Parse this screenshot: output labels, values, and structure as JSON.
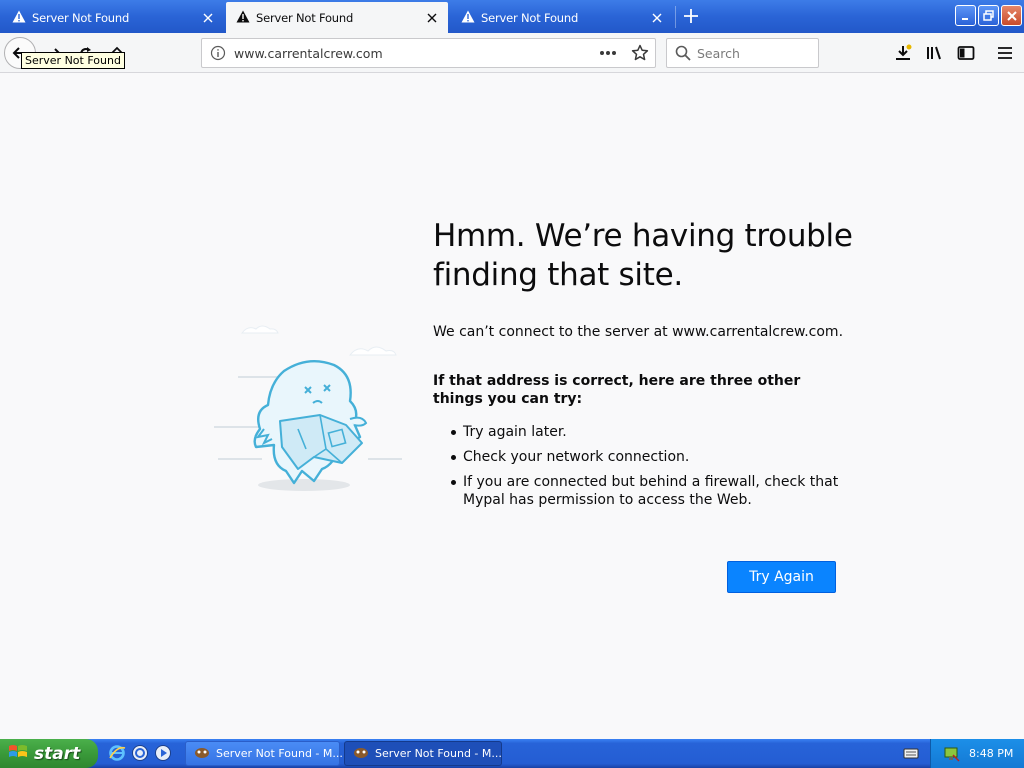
{
  "browser": {
    "tabs": [
      {
        "title": "Server Not Found",
        "state": "inactive"
      },
      {
        "title": "Server Not Found",
        "state": "active"
      },
      {
        "title": "Server Not Found",
        "state": "inactive"
      }
    ],
    "url": "www.carrentalcrew.com",
    "search_placeholder": "Search",
    "tooltip": "Server Not Found",
    "icons": [
      "warning-icon",
      "close-icon",
      "new-tab-icon",
      "back-icon",
      "forward-icon",
      "reload-icon",
      "home-icon",
      "info-icon",
      "page-actions-icon",
      "bookmark-star-icon",
      "search-icon",
      "downloads-icon",
      "library-icon",
      "sidebar-icon",
      "menu-icon"
    ]
  },
  "error_page": {
    "title": "Hmm. We’re having trouble finding that site.",
    "description": "We can’t connect to the server at www.carrentalcrew.com.",
    "suggestions_heading": "If that address is correct, here are three other things you can try:",
    "suggestions": [
      "Try again later.",
      "Check your network connection.",
      "If you are connected but behind a firewall, check that Mypal has permission to access the Web."
    ],
    "button_label": "Try Again",
    "accent_color": "#0a84ff"
  },
  "taskbar": {
    "start_label": "start",
    "buttons": [
      {
        "title": "Server Not Found - M...",
        "state": "normal"
      },
      {
        "title": "Server Not Found - M...",
        "state": "pressed"
      }
    ],
    "clock": "8:48 PM"
  }
}
